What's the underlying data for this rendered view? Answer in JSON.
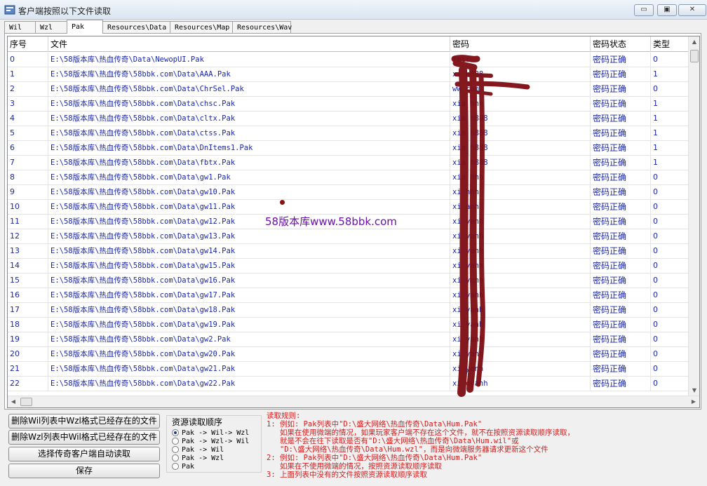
{
  "window": {
    "title": "客户端按照以下文件读取",
    "minimize_glyph": "▭",
    "maximize_glyph": "▣",
    "close_glyph": "✕"
  },
  "tabs": [
    {
      "label": "Wil",
      "active": false
    },
    {
      "label": "Wzl",
      "active": false
    },
    {
      "label": "Pak",
      "active": true
    },
    {
      "label": "Resources\\Data",
      "active": false
    },
    {
      "label": "Resources\\Map",
      "active": false
    },
    {
      "label": "Resources\\Wav",
      "active": false
    }
  ],
  "table": {
    "headers": [
      "序号",
      "文件",
      "密码",
      "密码状态",
      "类型"
    ],
    "rows": [
      [
        "0",
        "E:\\58版本库\\热血传奇\\Data\\NewopUI.Pak",
        "          fmir",
        "密码正确",
        "0"
      ],
      [
        "1",
        "E:\\58版本库\\热血传奇\\58bbk.com\\Data\\AAA.Pak",
        "xi     h888",
        "密码正确",
        "1"
      ],
      [
        "2",
        "E:\\58版本库\\热血传奇\\58bbk.com\\Data\\ChrSel.Pak",
        "ww         com",
        "密码正确",
        "0"
      ],
      [
        "3",
        "E:\\58版本库\\热血传奇\\58bbk.com\\Data\\chsc.Pak",
        "xia    hhh",
        "密码正确",
        "1"
      ],
      [
        "4",
        "E:\\58版本库\\热血传奇\\58bbk.com\\Data\\cltx.Pak",
        "xia    h888",
        "密码正确",
        "1"
      ],
      [
        "5",
        "E:\\58版本库\\热血传奇\\58bbk.com\\Data\\ctss.Pak",
        "xia    h888",
        "密码正确",
        "1"
      ],
      [
        "6",
        "E:\\58版本库\\热血传奇\\58bbk.com\\Data\\DnItems1.Pak",
        "xia    h888",
        "密码正确",
        "1"
      ],
      [
        "7",
        "E:\\58版本库\\热血传奇\\58bbk.com\\Data\\fbtx.Pak",
        "xia    h888",
        "密码正确",
        "1"
      ],
      [
        "8",
        "E:\\58版本库\\热血传奇\\58bbk.com\\Data\\gw1.Pak",
        "xia    hhh",
        "密码正确",
        "0"
      ],
      [
        "9",
        "E:\\58版本库\\热血传奇\\58bbk.com\\Data\\gw10.Pak",
        "xi    hhh",
        "密码正确",
        "0"
      ],
      [
        "10",
        "E:\\58版本库\\热血传奇\\58bbk.com\\Data\\gw11.Pak",
        "xi    anh",
        "密码正确",
        "0"
      ],
      [
        "11",
        "E:\\58版本库\\热血传奇\\58bbk.com\\Data\\gw12.Pak",
        "xi   yanh",
        "密码正确",
        "0"
      ],
      [
        "12",
        "E:\\58版本库\\热血传奇\\58bbk.com\\Data\\gw13.Pak",
        "xi   yanh",
        "密码正确",
        "0"
      ],
      [
        "13",
        "E:\\58版本库\\热血传奇\\58bbk.com\\Data\\gw14.Pak",
        "xi   yanh",
        "密码正确",
        "0"
      ],
      [
        "14",
        "E:\\58版本库\\热血传奇\\58bbk.com\\Data\\gw15.Pak",
        "xi   yanh",
        "密码正确",
        "0"
      ],
      [
        "15",
        "E:\\58版本库\\热血传奇\\58bbk.com\\Data\\gw16.Pak",
        "xi   yanh",
        "密码正确",
        "0"
      ],
      [
        "16",
        "E:\\58版本库\\热血传奇\\58bbk.com\\Data\\gw17.Pak",
        "xi   yanh",
        "密码正确",
        "0"
      ],
      [
        "17",
        "E:\\58版本库\\热血传奇\\58bbk.com\\Data\\gw18.Pak",
        "xi   yanh",
        "密码正确",
        "0"
      ],
      [
        "18",
        "E:\\58版本库\\热血传奇\\58bbk.com\\Data\\gw19.Pak",
        "xi   yanh",
        "密码正确",
        "0"
      ],
      [
        "19",
        "E:\\58版本库\\热血传奇\\58bbk.com\\Data\\gw2.Pak",
        "xi   yanh",
        "密码正确",
        "0"
      ],
      [
        "20",
        "E:\\58版本库\\热血传奇\\58bbk.com\\Data\\gw20.Pak",
        "xi   yanh",
        "密码正确",
        "0"
      ],
      [
        "21",
        "E:\\58版本库\\热血传奇\\58bbk.com\\Data\\gw21.Pak",
        "xi   yanh",
        "密码正确",
        "0"
      ],
      [
        "22",
        "E:\\58版本库\\热血传奇\\58bbk.com\\Data\\gw22.Pak",
        "xi   oyanh",
        "密码正确",
        "0"
      ]
    ]
  },
  "watermark": "58版本库www.58bbk.com",
  "buttons": {
    "delete_wil": "删除Wil列表中Wzl格式已经存在的文件",
    "delete_wzl": "删除Wzl列表中Wil格式已经存在的文件",
    "auto_read": "选择传奇客户端自动读取",
    "save": "保存"
  },
  "read_order": {
    "title": "资源读取顺序",
    "options": [
      {
        "label": "Pak -> Wil-> Wzl",
        "selected": true
      },
      {
        "label": "Pak -> Wzl-> Wil",
        "selected": false
      },
      {
        "label": "Pak -> Wil",
        "selected": false
      },
      {
        "label": "Pak -> Wzl",
        "selected": false
      },
      {
        "label": "Pak",
        "selected": false
      }
    ]
  },
  "rules": {
    "lines": [
      "读取规则:",
      "1: 例如: Pak列表中\"D:\\盛大网络\\热血传奇\\Data\\Hum.Pak\"",
      "   如果在使用微端的情况，如果玩家客户端不存在这个文件，就不在按照资源读取顺序读取，",
      "   就是不会在往下读取是否有\"D:\\盛大网络\\热血传奇\\Data\\Hum.wil\"或",
      "   \"D:\\盛大网络\\热血传奇\\Data\\Hum.wzl\"，而是向微端服务器请求更新这个文件",
      "2: 例如: Pak列表中\"D:\\盛大网络\\热血传奇\\Data\\Hum.Pak\"",
      "   如果在不使用微端的情况，按照资源读取顺序读取",
      "3: 上面列表中没有的文件按照资源读取顺序读取"
    ]
  }
}
